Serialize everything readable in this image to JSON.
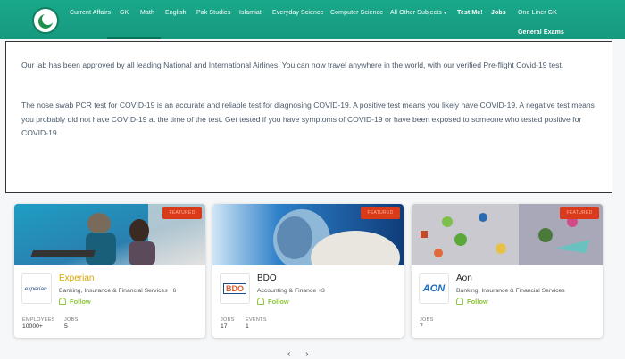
{
  "nav": {
    "items": [
      {
        "label": "Current Affairs",
        "bold": false
      },
      {
        "label": "GK",
        "bold": false
      },
      {
        "label": "Math",
        "bold": false
      },
      {
        "label": "English",
        "bold": false
      },
      {
        "label": "Pak Studies",
        "bold": false
      },
      {
        "label": "Islamiat",
        "bold": false
      },
      {
        "label": "Everyday Science",
        "bold": false
      },
      {
        "label": "Computer Science",
        "bold": false
      },
      {
        "label": "All Other Subjects",
        "bold": false
      },
      {
        "label": "Test Me!",
        "bold": true
      },
      {
        "label": "Jobs",
        "bold": true
      },
      {
        "label": "One Liner GK",
        "bold": false
      }
    ],
    "row2": {
      "label": "General Exams"
    }
  },
  "notice": {
    "p1": "Our lab has been approved by all leading National and International Airlines. You can now travel anywhere in the world, with our verified Pre-flight Covid-19 test.",
    "p2": "The nose swab PCR test for COVID-19 is an accurate and reliable test for diagnosing COVID-19. A positive test means you likely have COVID-19. A negative test means you probably did not have COVID-19 at the time of the test. Get tested if you have symptoms of COVID-19 or have been exposed to someone who tested positive for COVID-19."
  },
  "cards": [
    {
      "tag": "FEATURED",
      "name": "Experian",
      "logo_text": "experian.",
      "industry": "Banking, Insurance & Financial Services +6",
      "follow": "Follow",
      "stats": [
        {
          "label": "EMPLOYEES",
          "value": "10000+"
        },
        {
          "label": "JOBS",
          "value": "5"
        }
      ]
    },
    {
      "tag": "FEATURED",
      "name": "BDO",
      "logo_text": "BDO",
      "industry": "Accounting & Finance +3",
      "follow": "Follow",
      "stats": [
        {
          "label": "JOBS",
          "value": "17"
        },
        {
          "label": "EVENTS",
          "value": "1"
        }
      ]
    },
    {
      "tag": "FEATURED",
      "name": "Aon",
      "logo_text": "AON",
      "industry": "Banking, Insurance & Financial Services",
      "follow": "Follow",
      "stats": [
        {
          "label": "JOBS",
          "value": "7"
        }
      ]
    }
  ],
  "pager": {
    "prev": "‹",
    "next": "›"
  },
  "colors": {
    "nav": "#16997f",
    "tag": "#d93a1a",
    "follow": "#8ec63f"
  }
}
